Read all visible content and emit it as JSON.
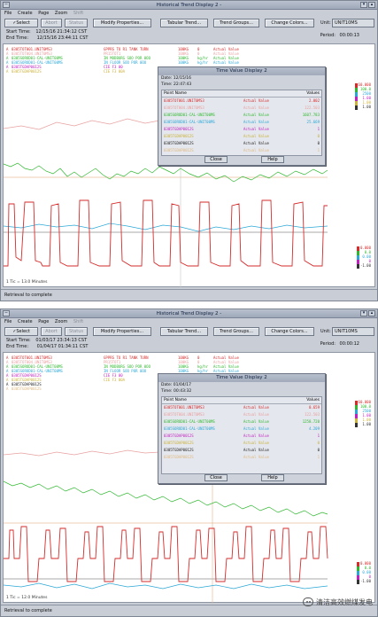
{
  "windows": [
    {
      "title": "Historical Trend Display 2 -",
      "menu": [
        "File",
        "Create",
        "Page",
        "Zoom",
        "Shift"
      ],
      "toolbar": {
        "select": "✓Select",
        "abort": "Abort",
        "status": "Status",
        "modify": "Modify Properties...",
        "tabular": "Tabular Trend...",
        "trend_groups": "Trend Groups...",
        "change_colors": "Change Colors...",
        "unit_label": "Unit:",
        "unit_value": "UNIT10MS"
      },
      "start_time_label": "Start Time:",
      "start_time": "12/15/16 21:34:12 CST",
      "end_time_label": "End Time:",
      "end_time": "12/15/16 23:44:11 CST",
      "period_label": "Period:",
      "period": "00:00:13",
      "legend": [
        {
          "marker": "A",
          "point": "0305TOT001.UNIT0MS3",
          "desc": "GPPRS TO R1 TANK TURN",
          "units": "100KG",
          "value": "0",
          "label": "Actual Value",
          "color": "#d62b2b"
        },
        {
          "marker": "A",
          "point": "0305TOT004.UNIT0MS3",
          "desc": "PR15TOT1",
          "units": "100KG",
          "value": "0",
          "label": "Actual Value",
          "color": "#e8a0a0"
        },
        {
          "marker": "A",
          "point": "0305SOROD01-CAL-UNIT00MS",
          "desc": "IN MODBURG SOO POR 0OO",
          "units": "100KG",
          "value": "kg/hr",
          "label": "Actual Value",
          "color": "#2fb82f"
        },
        {
          "marker": "A",
          "point": "0305SOROD01-CAL-UNIT00MS",
          "desc": "IN FLOOR SOO POR 0OO",
          "units": "100KG",
          "value": "kg/hr",
          "label": "Actual Value",
          "color": "#2aa7d6"
        },
        {
          "marker": "A",
          "point": "0305TGDAP0012S",
          "desc": "CIE F3 00",
          "units": "",
          "value": "",
          "label": "",
          "color": "#c21fc2"
        },
        {
          "marker": "A",
          "point": "0305TGDAP0012S",
          "desc": "CIE F3 00A",
          "units": "",
          "value": "",
          "label": "",
          "color": "#ccb23a"
        }
      ],
      "scale": [
        {
          "text": "60.000",
          "color": "#d62b2b"
        },
        {
          "text": "100.0",
          "color": "#2fb82f"
        },
        {
          "text": "2500",
          "color": "#2aa7d6"
        },
        {
          "text": "1.00",
          "color": "#c21fc2"
        },
        {
          "text": "1.00",
          "color": "#ccb23a"
        },
        {
          "text": "1.00",
          "color": "#333333"
        }
      ],
      "scale_low": [
        {
          "text": "0.000",
          "color": "#d62b2b"
        },
        {
          "text": "0.0",
          "color": "#2fb82f"
        },
        {
          "text": "0.00",
          "color": "#2aa7d6"
        },
        {
          "text": "0",
          "color": "#c21fc2"
        },
        {
          "text": "-1.00",
          "color": "#333333"
        }
      ],
      "footer_note": "1 Tic = 13.0 Minutes",
      "status": "Retrieval to complete",
      "dialog": {
        "title": "Time Value Display 2",
        "date_label": "Date:",
        "date": "12/15/16",
        "time_label": "Time:",
        "time": "22:47:43",
        "col_point": "Point Name",
        "col_values": "Values",
        "rows": [
          {
            "point": "0305TOT001.UNIT0MS3",
            "label": "Actual Value",
            "value": "2.002",
            "color": "#d62b2b"
          },
          {
            "point": "0305TOT004.UNIT0MS3",
            "label": "Actual Value",
            "value": "122.503",
            "color": "#e8a0a0"
          },
          {
            "point": "0305SOROD01-CAL-UNIT00MS",
            "label": "Actual Value",
            "value": "1607.783",
            "color": "#2fb82f"
          },
          {
            "point": "0305SOROD01-CAL-UNIT00MS",
            "label": "Actual Value",
            "value": "25.669",
            "color": "#2aa7d6"
          },
          {
            "point": "0305TGDAP0012S",
            "label": "Actual Value",
            "value": "1",
            "color": "#c21fc2"
          },
          {
            "point": "0305TGDAP0012S",
            "label": "Actual Value",
            "value": "0",
            "color": "#ccb23a"
          },
          {
            "point": "0305TGDAP0012S",
            "label": "Actual Value",
            "value": "0",
            "color": "#222222"
          },
          {
            "point": "0305TGDAP0012S",
            "label": "Actual Value",
            "value": "1",
            "color": "#e0b980"
          }
        ],
        "close": "Close",
        "help": "Help"
      }
    },
    {
      "title": "Historical Trend Display 2 -",
      "menu": [
        "File",
        "Create",
        "Page",
        "Zoom",
        "Shift"
      ],
      "toolbar": {
        "select": "✓Select",
        "abort": "Abort",
        "status": "Status",
        "modify": "Modify Properties...",
        "tabular": "Tabular Trend...",
        "trend_groups": "Trend Groups...",
        "change_colors": "Change Colors...",
        "unit_label": "Unit:",
        "unit_value": "UNIT10MS"
      },
      "start_time_label": "Start Time:",
      "start_time": "01/03/17 23:34:13 CST",
      "end_time_label": "End Time:",
      "end_time": "01/04/17 01:34:11 CST",
      "period_label": "Period:",
      "period": "00:00:12",
      "legend": [
        {
          "marker": "A",
          "point": "0305TOT001.UNIT0MS3",
          "desc": "GPPRS TO R1 TANK TURN",
          "units": "100KG",
          "value": "0",
          "label": "Actual Value",
          "color": "#d62b2b"
        },
        {
          "marker": "A",
          "point": "0305TOT004.UNIT0MS3",
          "desc": "PR15TOT1",
          "units": "100KG",
          "value": "0",
          "label": "Actual Value",
          "color": "#e8a0a0"
        },
        {
          "marker": "A",
          "point": "0305SOROD01-CAL-UNIT00MS",
          "desc": "IN MODBURG SOO POR 0OO",
          "units": "100KG",
          "value": "kg/hr",
          "label": "Actual Value",
          "color": "#2fb82f"
        },
        {
          "marker": "A",
          "point": "0305SOROD01-CAL-UNIT00MS",
          "desc": "IN FLOOR SOO POR 0OO",
          "units": "100KG",
          "value": "kg/hr",
          "label": "Actual Value",
          "color": "#2aa7d6"
        },
        {
          "marker": "A",
          "point": "0305TGDAP0012S",
          "desc": "CIE F3 00",
          "units": "",
          "value": "",
          "label": "",
          "color": "#c21fc2"
        },
        {
          "marker": "A",
          "point": "0305TGDAP0012S",
          "desc": "CIE F3 00A",
          "units": "",
          "value": "",
          "label": "",
          "color": "#ccb23a"
        },
        {
          "marker": "A",
          "point": "0305TGDAP0012S",
          "desc": "",
          "units": "",
          "value": "",
          "label": "",
          "color": "#222222"
        },
        {
          "marker": "A",
          "point": "0305TGDAP0012S",
          "desc": "",
          "units": "",
          "value": "",
          "label": "",
          "color": "#e0b980"
        }
      ],
      "scale": [
        {
          "text": "60.000",
          "color": "#d62b2b"
        },
        {
          "text": "100.0",
          "color": "#2fb82f"
        },
        {
          "text": "2500",
          "color": "#2aa7d6"
        },
        {
          "text": "1.00",
          "color": "#c21fc2"
        },
        {
          "text": "1.00",
          "color": "#ccb23a"
        },
        {
          "text": "1.00",
          "color": "#333333"
        }
      ],
      "scale_low": [
        {
          "text": "0.000",
          "color": "#d62b2b"
        },
        {
          "text": "0.0",
          "color": "#2fb82f"
        },
        {
          "text": "0.00",
          "color": "#2aa7d6"
        },
        {
          "text": "0",
          "color": "#c21fc2"
        },
        {
          "text": "-1.00",
          "color": "#333333"
        }
      ],
      "footer_note": "1 Tic = 12.0 Minutes",
      "status": "Retrieval to complete",
      "dialog": {
        "title": "Time Value Display 2",
        "date_label": "Date:",
        "date": "01/04/17",
        "time_label": "Time:",
        "time": "00:43:32",
        "col_point": "Point Name",
        "col_values": "Values",
        "rows": [
          {
            "point": "0305TOT001.UNIT0MS3",
            "label": "Actual Value",
            "value": "0.659",
            "color": "#d62b2b"
          },
          {
            "point": "0305TOT004.UNIT0MS3",
            "label": "Actual Value",
            "value": "122.503",
            "color": "#e8a0a0"
          },
          {
            "point": "0305SOROD01-CAL-UNIT00MS",
            "label": "Actual Value",
            "value": "1258.720",
            "color": "#2fb82f"
          },
          {
            "point": "0305SOROD01-CAL-UNIT00MS",
            "label": "Actual Value",
            "value": "4.209",
            "color": "#2aa7d6"
          },
          {
            "point": "0305TGDAP0012S",
            "label": "Actual Value",
            "value": "1",
            "color": "#c21fc2"
          },
          {
            "point": "0305TGDAP0012S",
            "label": "Actual Value",
            "value": "0",
            "color": "#ccb23a"
          },
          {
            "point": "0305TGDAP0012S",
            "label": "Actual Value",
            "value": "0",
            "color": "#222222"
          },
          {
            "point": "0305TGDAP0012S",
            "label": "Actual Value",
            "value": "1",
            "color": "#e0b980"
          }
        ],
        "close": "Close",
        "help": "Help"
      }
    }
  ],
  "watermark": {
    "text": "清洁高效燃煤发电",
    "icon": "wechat-icon"
  }
}
